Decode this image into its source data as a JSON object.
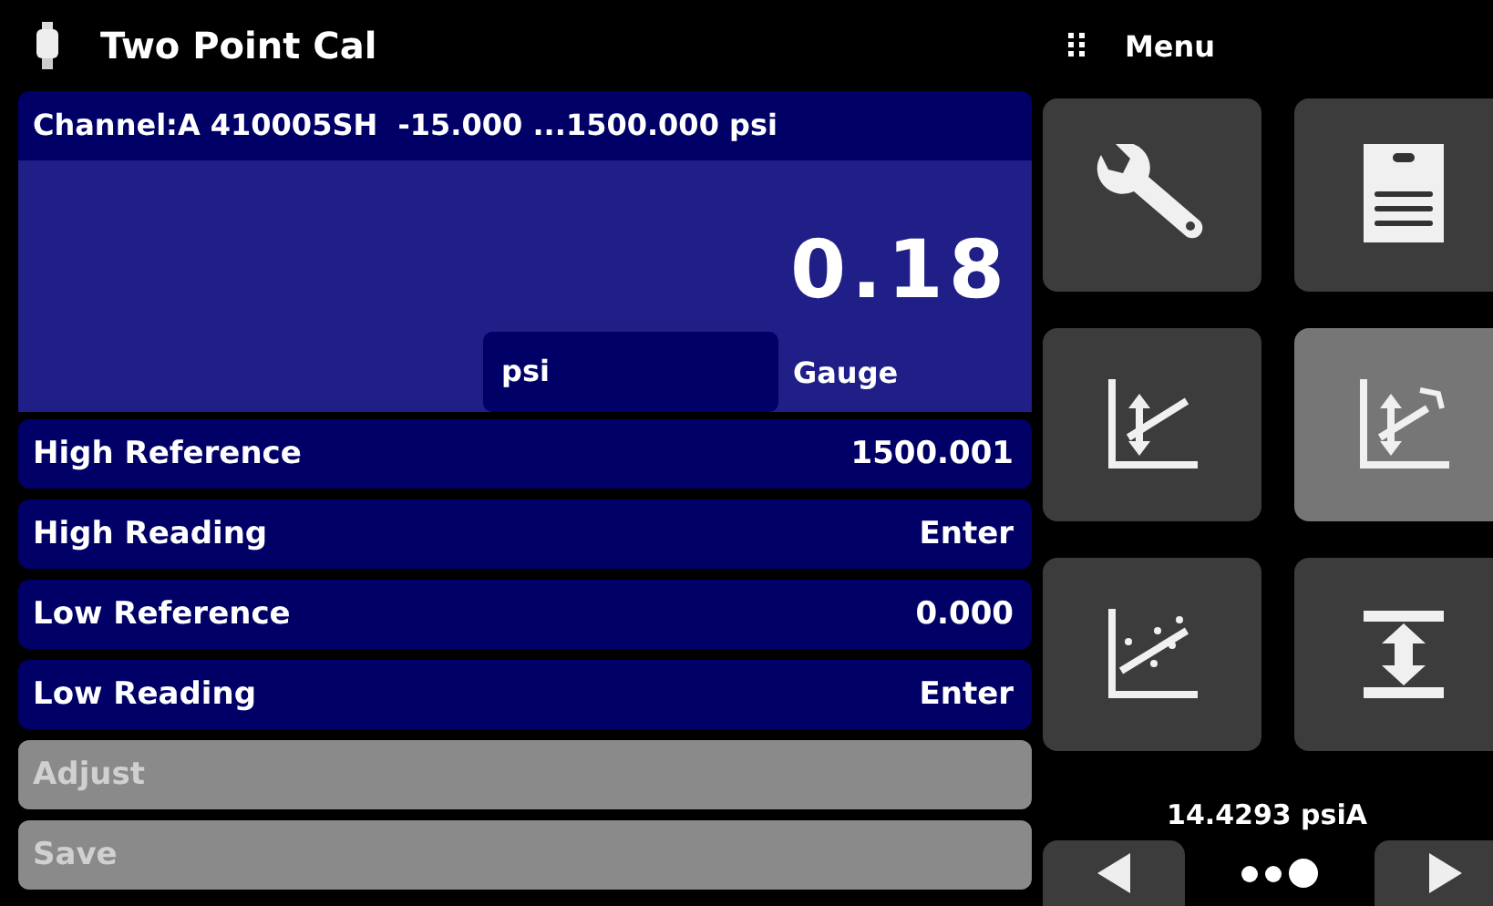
{
  "title_bar": {
    "title": "Two Point Cal",
    "menu_label": "Menu"
  },
  "channel_header": "Channel:A 410005SH  -15.000 ...1500.000 psi",
  "reading": "0.18",
  "unit_field": {
    "value": "psi"
  },
  "mode": "Gauge",
  "rows": [
    {
      "kind": "value",
      "label": "High Reference",
      "value": "1500.001",
      "disabled": false
    },
    {
      "kind": "value",
      "label": "High Reading",
      "value": "Enter",
      "disabled": false
    },
    {
      "kind": "value",
      "label": "Low Reference",
      "value": "0.000",
      "disabled": false
    },
    {
      "kind": "value",
      "label": "Low Reading",
      "value": "Enter",
      "disabled": false
    },
    {
      "kind": "action",
      "label": "Adjust",
      "disabled": true
    },
    {
      "kind": "action",
      "label": "Save",
      "disabled": true
    }
  ],
  "menu_tiles": [
    {
      "selected": false
    },
    {
      "selected": false
    },
    {
      "selected": false
    },
    {
      "selected": true
    },
    {
      "selected": false
    },
    {
      "selected": false
    }
  ],
  "barometer": "14.4293 psiA",
  "pages": [
    {
      "selected": false
    },
    {
      "selected": false
    },
    {
      "selected": true
    }
  ]
}
